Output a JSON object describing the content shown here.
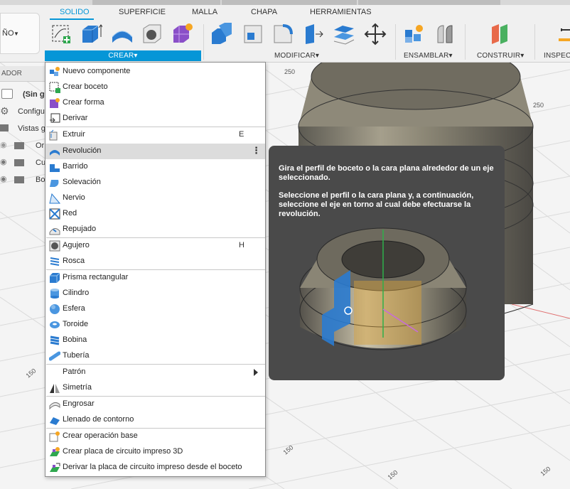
{
  "toolbar": {
    "design_button": "ÑO",
    "tabs": [
      "SOLIDO",
      "SUPERFICIE",
      "MALLA",
      "CHAPA",
      "HERRAMIENTAS"
    ],
    "groups": {
      "crear": "CREAR",
      "modificar": "MODIFICAR",
      "ensamblar": "ENSAMBLAR",
      "construir": "CONSTRUIR",
      "inspeccionar": "INSPECC"
    },
    "dropdown_arrow": "▾"
  },
  "browser": {
    "header": "ADOR",
    "rows": [
      "(Sin g",
      "Configu",
      "Vistas g",
      "Or",
      "Cu",
      "Bo"
    ]
  },
  "menu": {
    "items": [
      {
        "label": "Nuevo componente",
        "icon": "new-component-icon"
      },
      {
        "label": "Crear boceto",
        "icon": "create-sketch-icon"
      },
      {
        "label": "Crear forma",
        "icon": "create-form-icon"
      },
      {
        "label": "Derivar",
        "icon": "derive-icon"
      },
      {
        "label": "Extruir",
        "icon": "extrude-icon",
        "shortcut": "E"
      },
      {
        "label": "Revolución",
        "icon": "revolve-icon",
        "highlighted": true
      },
      {
        "label": "Barrido",
        "icon": "sweep-icon"
      },
      {
        "label": "Solevación",
        "icon": "loft-icon"
      },
      {
        "label": "Nervio",
        "icon": "rib-icon"
      },
      {
        "label": "Red",
        "icon": "web-icon"
      },
      {
        "label": "Repujado",
        "icon": "emboss-icon"
      },
      {
        "label": "Agujero",
        "icon": "hole-icon",
        "shortcut": "H"
      },
      {
        "label": "Rosca",
        "icon": "thread-icon"
      },
      {
        "label": "Prisma rectangular",
        "icon": "box-icon"
      },
      {
        "label": "Cilindro",
        "icon": "cylinder-icon"
      },
      {
        "label": "Esfera",
        "icon": "sphere-icon"
      },
      {
        "label": "Toroide",
        "icon": "torus-icon"
      },
      {
        "label": "Bobina",
        "icon": "coil-icon"
      },
      {
        "label": "Tubería",
        "icon": "pipe-icon"
      },
      {
        "label": "Patrón",
        "icon": "pattern-icon"
      },
      {
        "label": "Simetría",
        "icon": "mirror-icon"
      },
      {
        "label": "Engrosar",
        "icon": "thicken-icon"
      },
      {
        "label": "Llenado de contorno",
        "icon": "boundary-fill-icon"
      },
      {
        "label": "Crear operación base",
        "icon": "base-feature-icon"
      },
      {
        "label": "Crear placa de circuito impreso 3D",
        "icon": "pcb-3d-icon"
      },
      {
        "label": "Derivar la placa de circuito impreso desde el boceto",
        "icon": "pcb-derive-icon"
      }
    ],
    "more_glyph": "⋮"
  },
  "tooltip": {
    "title": "Gira el perfil de boceto o la cara plana alrededor de un eje seleccionado.",
    "body": "Seleccione el perfil o la cara plana y, a continuación, seleccione el eje en torno al cual debe efectuarse la revolución."
  },
  "viewport": {
    "grid_labels": [
      "250",
      "250",
      "150",
      "150",
      "150",
      "150"
    ]
  },
  "colors": {
    "accent": "#0696d7",
    "menu_highlight": "#dcdcdc",
    "tooltip_bg": "#4a4a4a"
  }
}
